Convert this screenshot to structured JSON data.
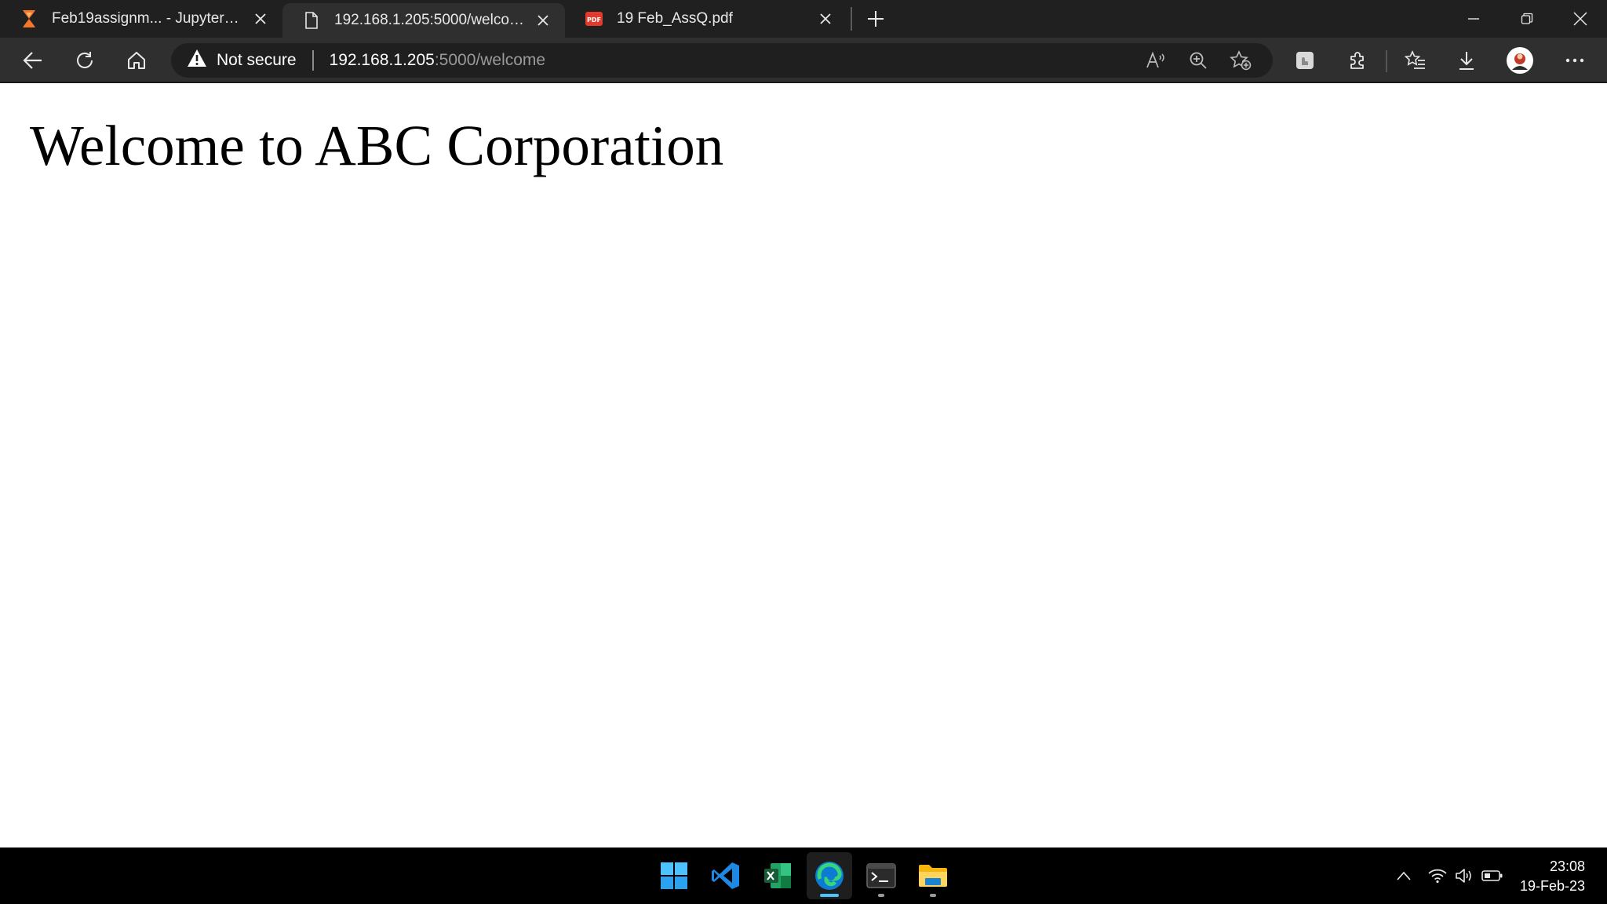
{
  "browser": {
    "tabs": [
      {
        "title": "Feb19assignm... - JupyterLab",
        "favicon": "jupyter-icon",
        "active": false
      },
      {
        "title": "192.168.1.205:5000/welcome",
        "favicon": "page-icon",
        "active": true
      },
      {
        "title": "19 Feb_AssQ.pdf",
        "favicon": "pdf-icon",
        "active": false
      }
    ],
    "address_bar": {
      "security_label": "Not secure",
      "url_host": "192.168.1.205",
      "url_rest": ":5000/welcome"
    }
  },
  "page": {
    "heading": "Welcome to ABC Corporation"
  },
  "taskbar": {
    "apps": [
      "windows-start-icon",
      "vscode-icon",
      "excel-icon",
      "edge-icon",
      "terminal-icon",
      "file-explorer-icon"
    ],
    "clock": {
      "time": "23:08",
      "date": "19-Feb-23"
    }
  },
  "colors": {
    "tabbar_bg": "#202020",
    "toolbar_bg": "#2f2f2f",
    "taskbar_bg": "#000000",
    "accent": "#4cc2ff"
  }
}
